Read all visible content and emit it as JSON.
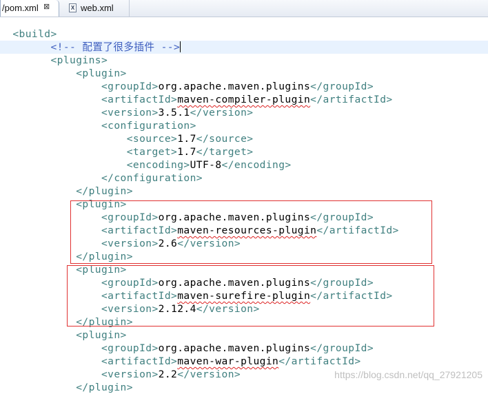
{
  "tabs": [
    {
      "label": "/pom.xml",
      "close": "⊠",
      "active": true,
      "icon": "none"
    },
    {
      "label": "web.xml",
      "active": false,
      "icon": "xml-file-icon",
      "icon_text": "X"
    }
  ],
  "editor": {
    "lines": [
      {
        "indent": "  ",
        "open": "<build>",
        "value": "",
        "close": ""
      },
      {
        "indent": "        ",
        "comment": "<!-- 配置了很多插件 -->",
        "current": true
      },
      {
        "indent": "        ",
        "open": "<plugins>",
        "value": "",
        "close": ""
      },
      {
        "indent": "            ",
        "open": "<plugin>",
        "value": "",
        "close": ""
      },
      {
        "indent": "                ",
        "open": "<groupId>",
        "value": "org.apache.maven.plugins",
        "close": "</groupId>"
      },
      {
        "indent": "                ",
        "open": "<artifactId>",
        "value": "maven-compiler-plugin",
        "close": "</artifactId>",
        "squiggle": true
      },
      {
        "indent": "                ",
        "open": "<version>",
        "value": "3.5.1",
        "close": "</version>"
      },
      {
        "indent": "                ",
        "open": "<configuration>",
        "value": "",
        "close": ""
      },
      {
        "indent": "                    ",
        "open": "<source>",
        "value": "1.7",
        "close": "</source>"
      },
      {
        "indent": "                    ",
        "open": "<target>",
        "value": "1.7",
        "close": "</target>"
      },
      {
        "indent": "                    ",
        "open": "<encoding>",
        "value": "UTF-8",
        "close": "</encoding>"
      },
      {
        "indent": "                ",
        "open": "</configuration>",
        "value": "",
        "close": ""
      },
      {
        "indent": "            ",
        "open": "</plugin>",
        "value": "",
        "close": ""
      },
      {
        "indent": "            ",
        "open": "<plugin>",
        "value": "",
        "close": ""
      },
      {
        "indent": "                ",
        "open": "<groupId>",
        "value": "org.apache.maven.plugins",
        "close": "</groupId>"
      },
      {
        "indent": "                ",
        "open": "<artifactId>",
        "value": "maven-resources-plugin",
        "close": "</artifactId>",
        "squiggle": true
      },
      {
        "indent": "                ",
        "open": "<version>",
        "value": "2.6",
        "close": "</version>"
      },
      {
        "indent": "            ",
        "open": "</plugin>",
        "value": "",
        "close": ""
      },
      {
        "indent": "            ",
        "open": "<plugin>",
        "value": "",
        "close": ""
      },
      {
        "indent": "                ",
        "open": "<groupId>",
        "value": "org.apache.maven.plugins",
        "close": "</groupId>"
      },
      {
        "indent": "                ",
        "open": "<artifactId>",
        "value": "maven-surefire-plugin",
        "close": "</artifactId>",
        "squiggle": true
      },
      {
        "indent": "                ",
        "open": "<version>",
        "value": "2.12.4",
        "close": "</version>"
      },
      {
        "indent": "            ",
        "open": "</plugin>",
        "value": "",
        "close": ""
      },
      {
        "indent": "            ",
        "open": "<plugin>",
        "value": "",
        "close": ""
      },
      {
        "indent": "                ",
        "open": "<groupId>",
        "value": "org.apache.maven.plugins",
        "close": "</groupId>"
      },
      {
        "indent": "                ",
        "open": "<artifactId>",
        "value": "maven-war-plugin",
        "close": "</artifactId>",
        "squiggle": true
      },
      {
        "indent": "                ",
        "open": "<version>",
        "value": "2.2",
        "close": "</version>"
      },
      {
        "indent": "            ",
        "open": "</plugin>",
        "value": "",
        "close": ""
      }
    ]
  },
  "watermark": "https://blog.csdn.net/qq_27921205",
  "colors": {
    "tag": "#3f7f7f",
    "comment": "#3f5fbf",
    "text": "#000000",
    "current_line": "#e8f2fe",
    "annotation_box": "#e03030"
  }
}
